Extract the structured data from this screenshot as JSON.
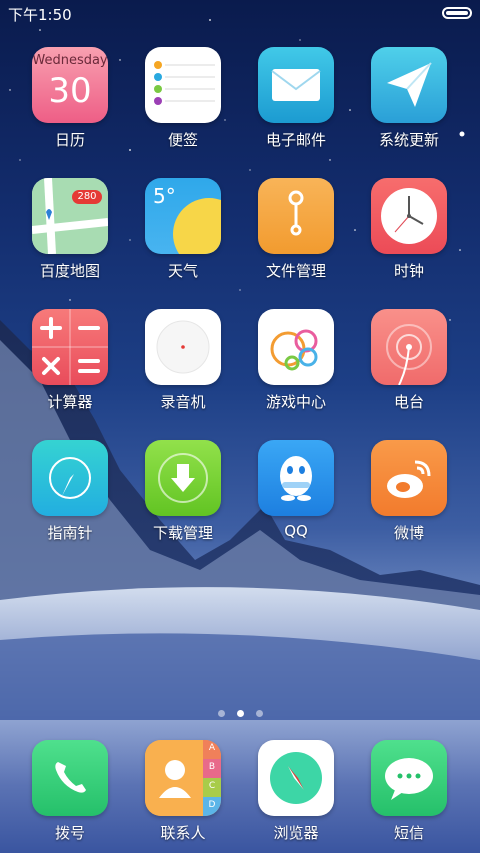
{
  "status": {
    "time": "下午1:50"
  },
  "calendar": {
    "weekday": "Wednesday",
    "day": "30"
  },
  "weather": {
    "temp": "5°"
  },
  "map": {
    "badge": "280"
  },
  "contacts": {
    "index": [
      "A",
      "B",
      "C",
      "D"
    ]
  },
  "apps": [
    {
      "label": "日历"
    },
    {
      "label": "便签"
    },
    {
      "label": "电子邮件"
    },
    {
      "label": "系统更新"
    },
    {
      "label": "百度地图"
    },
    {
      "label": "天气"
    },
    {
      "label": "文件管理"
    },
    {
      "label": "时钟"
    },
    {
      "label": "计算器"
    },
    {
      "label": "录音机"
    },
    {
      "label": "游戏中心"
    },
    {
      "label": "电台"
    },
    {
      "label": "指南针"
    },
    {
      "label": "下载管理"
    },
    {
      "label": "QQ"
    },
    {
      "label": "微博"
    }
  ],
  "dock": [
    {
      "label": "拨号"
    },
    {
      "label": "联系人"
    },
    {
      "label": "浏览器"
    },
    {
      "label": "短信"
    }
  ],
  "page_indicator": {
    "count": 3,
    "active": 2
  }
}
